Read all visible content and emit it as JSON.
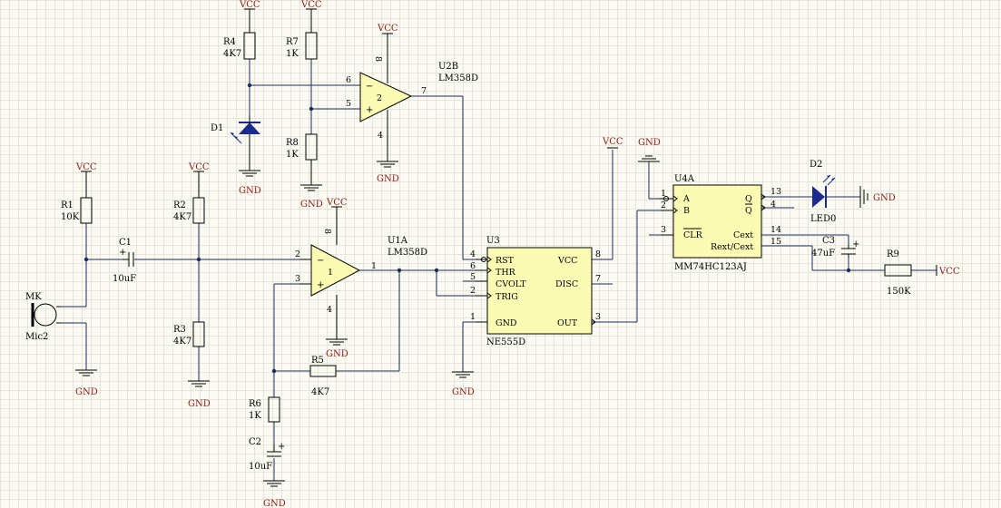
{
  "power": {
    "vcc": "VCC",
    "gnd": "GND"
  },
  "components": {
    "R4": {
      "ref": "R4",
      "val": "4K7"
    },
    "R7": {
      "ref": "R7",
      "val": "1K"
    },
    "R8": {
      "ref": "R8",
      "val": "1K"
    },
    "R1": {
      "ref": "R1",
      "val": "10K"
    },
    "R2": {
      "ref": "R2",
      "val": "4K7"
    },
    "R3": {
      "ref": "R3",
      "val": "4K7"
    },
    "R5": {
      "ref": "R5",
      "val": "4K7"
    },
    "R6": {
      "ref": "R6",
      "val": "1K"
    },
    "R9": {
      "ref": "R9",
      "val": "150K"
    },
    "C1": {
      "ref": "C1",
      "val": "10uF"
    },
    "C2": {
      "ref": "C2",
      "val": "10uF"
    },
    "C3": {
      "ref": "C3",
      "val": "47uF"
    },
    "D1": {
      "ref": "D1"
    },
    "D2": {
      "ref": "D2",
      "val": "LED0"
    },
    "MK": {
      "ref": "MK",
      "val": "Mic2"
    },
    "U2B": {
      "ref": "U2B",
      "val": "LM358D",
      "unit": "2"
    },
    "U1A": {
      "ref": "U1A",
      "val": "LM358D",
      "unit": "1"
    },
    "U3": {
      "ref": "U3",
      "val": "NE555D"
    },
    "U4A": {
      "ref": "U4A",
      "val": "MM74HC123AJ"
    }
  },
  "ne555": {
    "left_pins": [
      "RST",
      "THR",
      "CVOLT",
      "TRIG",
      "GND"
    ],
    "right_pins": [
      "VCC",
      "DISC",
      "OUT"
    ],
    "pin_nums": [
      "4",
      "6",
      "5",
      "2",
      "1",
      "8",
      "7",
      "3"
    ]
  },
  "hc123": {
    "left_pins": [
      "A",
      "B",
      "CLR"
    ],
    "right_pins": [
      "Q",
      "Q",
      "Cext",
      "Rext/Cext"
    ],
    "pin_nums": [
      "1",
      "2",
      "3",
      "13",
      "4",
      "14",
      "15"
    ]
  },
  "opamp_pins": {
    "u2b": [
      "6",
      "5",
      "7",
      "8",
      "4"
    ],
    "u1a": [
      "2",
      "3",
      "1",
      "8",
      "4"
    ]
  }
}
